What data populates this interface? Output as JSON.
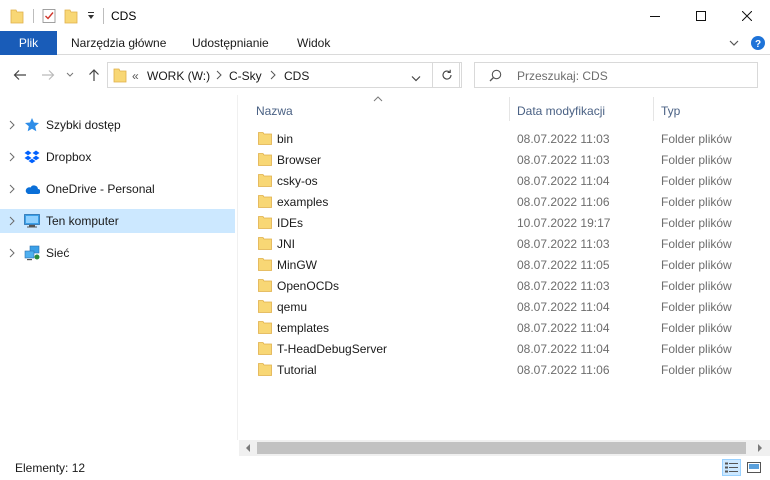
{
  "window": {
    "title": "CDS",
    "minimize_label": "—",
    "maximize_label": "☐",
    "close_label": "✕"
  },
  "ribbon": {
    "file_tab": "Plik",
    "tabs": [
      {
        "label": "Narzędzia główne"
      },
      {
        "label": "Udostępnianie"
      },
      {
        "label": "Widok"
      }
    ]
  },
  "address": {
    "overflow": "«",
    "crumbs": [
      "WORK (W:)",
      "C-Sky",
      "CDS"
    ]
  },
  "search": {
    "placeholder": "Przeszukaj: CDS"
  },
  "navpane": {
    "items": [
      {
        "label": "Szybki dostęp",
        "icon": "star-icon",
        "selected": false
      },
      {
        "label": "Dropbox",
        "icon": "dropbox-icon",
        "selected": false
      },
      {
        "label": "OneDrive - Personal",
        "icon": "cloud-icon",
        "selected": false
      },
      {
        "label": "Ten komputer",
        "icon": "computer-icon",
        "selected": true
      },
      {
        "label": "Sieć",
        "icon": "network-icon",
        "selected": false
      }
    ]
  },
  "columns": {
    "name": "Nazwa",
    "date": "Data modyfikacji",
    "type": "Typ"
  },
  "files": [
    {
      "name": "bin",
      "date": "08.07.2022 11:03",
      "type": "Folder plików"
    },
    {
      "name": "Browser",
      "date": "08.07.2022 11:03",
      "type": "Folder plików"
    },
    {
      "name": "csky-os",
      "date": "08.07.2022 11:04",
      "type": "Folder plików"
    },
    {
      "name": "examples",
      "date": "08.07.2022 11:06",
      "type": "Folder plików"
    },
    {
      "name": "IDEs",
      "date": "10.07.2022 19:17",
      "type": "Folder plików"
    },
    {
      "name": "JNI",
      "date": "08.07.2022 11:03",
      "type": "Folder plików"
    },
    {
      "name": "MinGW",
      "date": "08.07.2022 11:05",
      "type": "Folder plików"
    },
    {
      "name": "OpenOCDs",
      "date": "08.07.2022 11:03",
      "type": "Folder plików"
    },
    {
      "name": "qemu",
      "date": "08.07.2022 11:04",
      "type": "Folder plików"
    },
    {
      "name": "templates",
      "date": "08.07.2022 11:04",
      "type": "Folder plików"
    },
    {
      "name": "T-HeadDebugServer",
      "date": "08.07.2022 11:04",
      "type": "Folder plików"
    },
    {
      "name": "Tutorial",
      "date": "08.07.2022 11:06",
      "type": "Folder plików"
    }
  ],
  "status": {
    "item_count": "Elementy: 12"
  },
  "colors": {
    "accent": "#195cb8",
    "selection": "#cce8ff",
    "folder": "#f8d775",
    "folder_dark": "#e8b64a"
  }
}
